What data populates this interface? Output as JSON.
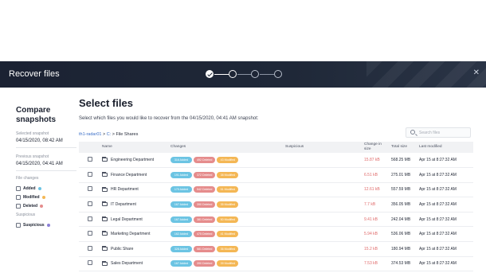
{
  "header": {
    "title": "Recover files",
    "close_icon": "close-icon"
  },
  "stepper": {
    "steps": 4,
    "completed": 1,
    "current": 2
  },
  "left": {
    "title_line1": "Compare",
    "title_line2": "snapshots",
    "selected_label": "Selected snapshot",
    "selected_date": "04/15/2020, 08:42 AM",
    "previous_label": "Previous snapshot",
    "previous_date": "04/15/2020, 04:41 AM",
    "file_changes_label": "File changes",
    "filters": [
      {
        "label": "Added",
        "color": "#6cc4e3"
      },
      {
        "label": "Modified",
        "color": "#f4b755"
      },
      {
        "label": "Deleted",
        "color": "#e58c8c"
      }
    ],
    "suspicious_group_label": "Suspicious",
    "suspicious_filter": {
      "label": "Suspicious",
      "color": "#8b7fd6"
    }
  },
  "main": {
    "title": "Select files",
    "subtitle": "Select which files you would like to recover from the 04/15/2020, 04:41 AM snapshot:",
    "breadcrumb": {
      "host": "th1-radar01",
      "drive": "C:",
      "folder": "File Shares"
    },
    "search_placeholder": "Search files",
    "columns": {
      "name": "Name",
      "changes": "Changes",
      "suspicious": "Suspicious",
      "change_in_size": "Change in size",
      "total_size": "Total size",
      "last_modified": "Last modified"
    },
    "rows": [
      {
        "name": "Engineering Department",
        "added": "316 Added",
        "deleted": "492 Deleted",
        "modified": "43 Modified",
        "suspicious": "",
        "change_in_size": "15.87 kB",
        "total_size": "568.25 MB",
        "last_modified": "Apr 15 at 8:27:32 AM"
      },
      {
        "name": "Finance Department",
        "added": "191 Added",
        "deleted": "372 Deleted",
        "modified": "38 Modified",
        "suspicious": "",
        "change_in_size": "6.51 kB",
        "total_size": "275.01 MB",
        "last_modified": "Apr 15 at 8:27:32 AM"
      },
      {
        "name": "HR Department",
        "added": "170 Added",
        "deleted": "542 Deleted",
        "modified": "51 Modified",
        "suspicious": "",
        "change_in_size": "12.61 kB",
        "total_size": "557.59 MB",
        "last_modified": "Apr 15 at 8:27:32 AM"
      },
      {
        "name": "IT Department",
        "added": "167 Added",
        "deleted": "390 Deleted",
        "modified": "35 Modified",
        "suspicious": "",
        "change_in_size": "7.7 kB",
        "total_size": "356.05 MB",
        "last_modified": "Apr 15 at 8:27:32 AM"
      },
      {
        "name": "Legal Department",
        "added": "167 Added",
        "deleted": "381 Deleted",
        "modified": "50 Modified",
        "suspicious": "",
        "change_in_size": "9.41 kB",
        "total_size": "242.04 MB",
        "last_modified": "Apr 15 at 8:27:32 AM"
      },
      {
        "name": "Marketing Department",
        "added": "162 Added",
        "deleted": "475 Deleted",
        "modified": "41 Modified",
        "suspicious": "",
        "change_in_size": "5.94 kB",
        "total_size": "536.06 MB",
        "last_modified": "Apr 15 at 8:27:32 AM"
      },
      {
        "name": "Public Share",
        "added": "328 Added",
        "deleted": "581 Deleted",
        "modified": "36 Modified",
        "suspicious": "",
        "change_in_size": "15.2 kB",
        "total_size": "180.94 MB",
        "last_modified": "Apr 15 at 8:27:32 AM"
      },
      {
        "name": "Sales Department",
        "added": "167 Added",
        "deleted": "390 Deleted",
        "modified": "39 Modified",
        "suspicious": "",
        "change_in_size": "7.53 kB",
        "total_size": "374.53 MB",
        "last_modified": "Apr 15 at 8:27:32 AM"
      }
    ]
  }
}
